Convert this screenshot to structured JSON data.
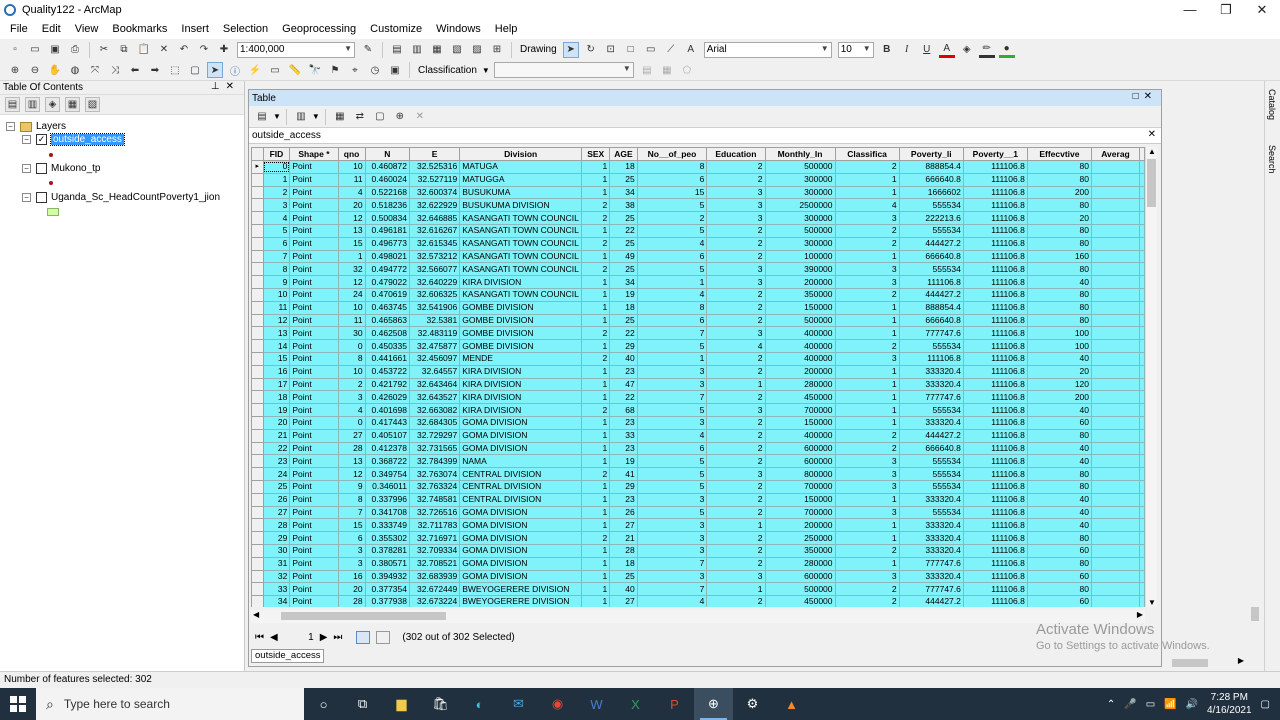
{
  "window": {
    "title": "Quality122 - ArcMap"
  },
  "menu": [
    "File",
    "Edit",
    "View",
    "Bookmarks",
    "Insert",
    "Selection",
    "Geoprocessing",
    "Customize",
    "Windows",
    "Help"
  ],
  "toolbar": {
    "scale": "1:400,000",
    "drawing_label": "Drawing",
    "font_name": "Arial",
    "font_size": "10",
    "bold": "B",
    "italic": "I",
    "underline": "U",
    "classification_label": "Classification"
  },
  "toc": {
    "title": "Table Of Contents",
    "root": "Layers",
    "layers": [
      {
        "name": "outside_access",
        "checked": true
      },
      {
        "name": "Mukono_tp",
        "checked": false
      },
      {
        "name": "Uganda_Sc_HeadCountPoverty1_jion",
        "checked": false
      }
    ]
  },
  "table_window": {
    "title": "Table",
    "layer_name": "outside_access",
    "columns": [
      "FID",
      "Shape *",
      "qno",
      "N",
      "E",
      "Division",
      "SEX",
      "AGE",
      "No__of_peo",
      "Education",
      "Monthly_In",
      "Classifica",
      "Poverty_li",
      "Poverty__1",
      "Effecvtive",
      "Averag"
    ],
    "rows": [
      [
        "0",
        "Point",
        "10",
        "0.460872",
        "32.525316",
        "MATUGA",
        "1",
        "18",
        "8",
        "2",
        "500000",
        "2",
        "888854.4",
        "111106.8",
        "80",
        ""
      ],
      [
        "1",
        "Point",
        "11",
        "0.460024",
        "32.527119",
        "MATUGGA",
        "1",
        "25",
        "6",
        "2",
        "300000",
        "1",
        "666640.8",
        "111106.8",
        "80",
        ""
      ],
      [
        "2",
        "Point",
        "4",
        "0.522168",
        "32.600374",
        "BUSUKUMA",
        "1",
        "34",
        "15",
        "3",
        "300000",
        "1",
        "1666602",
        "111106.8",
        "200",
        ""
      ],
      [
        "3",
        "Point",
        "20",
        "0.518236",
        "32.622929",
        "BUSUKUMA DIVISION",
        "2",
        "38",
        "5",
        "3",
        "2500000",
        "4",
        "555534",
        "111106.8",
        "80",
        ""
      ],
      [
        "4",
        "Point",
        "12",
        "0.500834",
        "32.646885",
        "KASANGATI TOWN COUNCIL",
        "2",
        "25",
        "2",
        "3",
        "300000",
        "3",
        "222213.6",
        "111106.8",
        "20",
        ""
      ],
      [
        "5",
        "Point",
        "13",
        "0.496181",
        "32.616267",
        "KASANGATI TOWN COUNCIL",
        "1",
        "22",
        "5",
        "2",
        "500000",
        "2",
        "555534",
        "111106.8",
        "80",
        ""
      ],
      [
        "6",
        "Point",
        "15",
        "0.496773",
        "32.615345",
        "KASANGATI TOWN COUNCIL",
        "2",
        "25",
        "4",
        "2",
        "300000",
        "2",
        "444427.2",
        "111106.8",
        "80",
        ""
      ],
      [
        "7",
        "Point",
        "1",
        "0.498021",
        "32.573212",
        "KASANGATI TOWN COUNCIL",
        "1",
        "49",
        "6",
        "2",
        "100000",
        "1",
        "666640.8",
        "111106.8",
        "160",
        ""
      ],
      [
        "8",
        "Point",
        "32",
        "0.494772",
        "32.566077",
        "KASANGATI TOWN COUNCIL",
        "2",
        "25",
        "5",
        "3",
        "390000",
        "3",
        "555534",
        "111106.8",
        "80",
        ""
      ],
      [
        "9",
        "Point",
        "12",
        "0.479022",
        "32.640229",
        "KIRA DIVISION",
        "1",
        "34",
        "1",
        "3",
        "200000",
        "3",
        "111106.8",
        "111106.8",
        "40",
        ""
      ],
      [
        "10",
        "Point",
        "24",
        "0.470619",
        "32.606325",
        "KASANGATI TOWN COUNCIL",
        "1",
        "19",
        "4",
        "2",
        "350000",
        "2",
        "444427.2",
        "111106.8",
        "80",
        ""
      ],
      [
        "11",
        "Point",
        "10",
        "0.463745",
        "32.541906",
        "GOMBE DIVISION",
        "1",
        "18",
        "8",
        "2",
        "150000",
        "1",
        "888854.4",
        "111106.8",
        "80",
        ""
      ],
      [
        "12",
        "Point",
        "11",
        "0.465863",
        "32.5381",
        "GOMBE DIVISION",
        "1",
        "25",
        "6",
        "2",
        "500000",
        "1",
        "666640.8",
        "111106.8",
        "80",
        ""
      ],
      [
        "13",
        "Point",
        "30",
        "0.462508",
        "32.483119",
        "GOMBE DIVISION",
        "2",
        "22",
        "7",
        "3",
        "400000",
        "1",
        "777747.6",
        "111106.8",
        "100",
        ""
      ],
      [
        "14",
        "Point",
        "0",
        "0.450335",
        "32.475877",
        "GOMBE DIVISION",
        "1",
        "29",
        "5",
        "4",
        "400000",
        "2",
        "555534",
        "111106.8",
        "100",
        ""
      ],
      [
        "15",
        "Point",
        "8",
        "0.441661",
        "32.456097",
        "MENDE",
        "2",
        "40",
        "1",
        "2",
        "400000",
        "3",
        "111106.8",
        "111106.8",
        "40",
        ""
      ],
      [
        "16",
        "Point",
        "10",
        "0.453722",
        "32.64557",
        "KIRA DIVISION",
        "1",
        "23",
        "3",
        "2",
        "200000",
        "1",
        "333320.4",
        "111106.8",
        "20",
        ""
      ],
      [
        "17",
        "Point",
        "2",
        "0.421792",
        "32.643464",
        "KIRA DIVISION",
        "1",
        "47",
        "3",
        "1",
        "280000",
        "1",
        "333320.4",
        "111106.8",
        "120",
        ""
      ],
      [
        "18",
        "Point",
        "3",
        "0.426029",
        "32.643527",
        "KIRA DIVISION",
        "1",
        "22",
        "7",
        "2",
        "450000",
        "1",
        "777747.6",
        "111106.8",
        "200",
        ""
      ],
      [
        "19",
        "Point",
        "4",
        "0.401698",
        "32.663082",
        "KIRA DIVISION",
        "2",
        "68",
        "5",
        "3",
        "700000",
        "1",
        "555534",
        "111106.8",
        "40",
        ""
      ],
      [
        "20",
        "Point",
        "0",
        "0.417443",
        "32.684305",
        "GOMA DIVISION",
        "1",
        "23",
        "3",
        "2",
        "150000",
        "1",
        "333320.4",
        "111106.8",
        "60",
        ""
      ],
      [
        "21",
        "Point",
        "27",
        "0.405107",
        "32.729297",
        "GOMA DIVISION",
        "1",
        "33",
        "4",
        "2",
        "400000",
        "2",
        "444427.2",
        "111106.8",
        "80",
        ""
      ],
      [
        "22",
        "Point",
        "28",
        "0.412378",
        "32.731565",
        "GOMA DIVISION",
        "1",
        "23",
        "6",
        "2",
        "600000",
        "2",
        "666640.8",
        "111106.8",
        "40",
        ""
      ],
      [
        "23",
        "Point",
        "13",
        "0.368722",
        "32.784399",
        "NAMA",
        "1",
        "19",
        "5",
        "2",
        "600000",
        "3",
        "555534",
        "111106.8",
        "40",
        ""
      ],
      [
        "24",
        "Point",
        "12",
        "0.349754",
        "32.763074",
        "CENTRAL DIVISION",
        "2",
        "41",
        "5",
        "3",
        "800000",
        "3",
        "555534",
        "111106.8",
        "80",
        ""
      ],
      [
        "25",
        "Point",
        "9",
        "0.346011",
        "32.763324",
        "CENTRAL DIVISION",
        "1",
        "29",
        "5",
        "2",
        "700000",
        "3",
        "555534",
        "111106.8",
        "80",
        ""
      ],
      [
        "26",
        "Point",
        "8",
        "0.337996",
        "32.748581",
        "CENTRAL DIVISION",
        "1",
        "23",
        "3",
        "2",
        "150000",
        "1",
        "333320.4",
        "111106.8",
        "40",
        ""
      ],
      [
        "27",
        "Point",
        "7",
        "0.341708",
        "32.726516",
        "GOMA DIVISION",
        "1",
        "26",
        "5",
        "2",
        "700000",
        "3",
        "555534",
        "111106.8",
        "40",
        ""
      ],
      [
        "28",
        "Point",
        "15",
        "0.333749",
        "32.711783",
        "GOMA DIVISION",
        "1",
        "27",
        "3",
        "1",
        "200000",
        "1",
        "333320.4",
        "111106.8",
        "40",
        ""
      ],
      [
        "29",
        "Point",
        "6",
        "0.355302",
        "32.716971",
        "GOMA DIVISION",
        "2",
        "21",
        "3",
        "2",
        "250000",
        "1",
        "333320.4",
        "111106.8",
        "80",
        ""
      ],
      [
        "30",
        "Point",
        "3",
        "0.378281",
        "32.709334",
        "GOMA DIVISION",
        "1",
        "28",
        "3",
        "2",
        "350000",
        "2",
        "333320.4",
        "111106.8",
        "60",
        ""
      ],
      [
        "31",
        "Point",
        "3",
        "0.380571",
        "32.708521",
        "GOMA DIVISION",
        "1",
        "18",
        "7",
        "2",
        "280000",
        "1",
        "777747.6",
        "111106.8",
        "80",
        ""
      ],
      [
        "32",
        "Point",
        "16",
        "0.394932",
        "32.683939",
        "GOMA DIVISION",
        "1",
        "25",
        "3",
        "3",
        "600000",
        "3",
        "333320.4",
        "111106.8",
        "60",
        ""
      ],
      [
        "33",
        "Point",
        "20",
        "0.377354",
        "32.672449",
        "BWEYOGERERE DIVISION",
        "1",
        "40",
        "7",
        "1",
        "500000",
        "2",
        "777747.6",
        "111106.8",
        "80",
        ""
      ],
      [
        "34",
        "Point",
        "28",
        "0.377938",
        "32.673224",
        "BWEYOGERERE DIVISION",
        "1",
        "27",
        "4",
        "2",
        "450000",
        "2",
        "444427.2",
        "111106.8",
        "60",
        ""
      ]
    ],
    "nav_page": "1",
    "selection_text": "(302 out of 302 Selected)",
    "tab_label": "outside_access"
  },
  "dock": {
    "catalog": "Catalog",
    "search": "Search"
  },
  "watermark": {
    "line1": "Activate Windows",
    "line2": "Go to Settings to activate Windows."
  },
  "status": {
    "text": "Number of features selected: 302"
  },
  "taskbar": {
    "search_placeholder": "Type here to search",
    "time": "7:28 PM",
    "date": "4/16/2021"
  },
  "colors": {
    "row_selected": "#7ff3f9",
    "taskbar": "#20303e",
    "toc_highlight": "#3399ff"
  }
}
